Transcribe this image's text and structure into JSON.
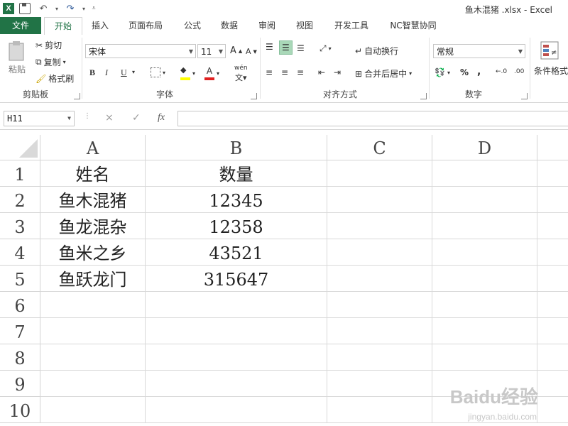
{
  "window": {
    "title": "鱼木混猪 .xlsx - Excel"
  },
  "tabs": [
    "文件",
    "开始",
    "插入",
    "页面布局",
    "公式",
    "数据",
    "审阅",
    "视图",
    "开发工具",
    "NC智慧协同"
  ],
  "ribbon": {
    "clipboard": {
      "paste": "粘贴",
      "cut": "剪切",
      "copy": "复制",
      "format_painter": "格式刷",
      "label": "剪贴板"
    },
    "font": {
      "name": "宋体",
      "size": "11",
      "label": "字体",
      "bold": "B",
      "italic": "I",
      "underline": "U",
      "phonetic": "wén"
    },
    "align": {
      "wrap": "自动换行",
      "merge": "合并后居中",
      "label": "对齐方式"
    },
    "number": {
      "format": "常规",
      "label": "数字",
      "percent": "%",
      "comma": ","
    },
    "styles": {
      "conditional": "条件格式"
    }
  },
  "formula_bar": {
    "name_box": "H11",
    "fx": "fx",
    "cancel": "×",
    "enter": "✓",
    "value": ""
  },
  "columns": [
    "A",
    "B",
    "C",
    "D"
  ],
  "rows": [
    "1",
    "2",
    "3",
    "4",
    "5",
    "6",
    "7",
    "8",
    "9",
    "10"
  ],
  "cells": [
    [
      "姓名",
      "数量"
    ],
    [
      "鱼木混猪",
      "12345"
    ],
    [
      "鱼龙混杂",
      "12358"
    ],
    [
      "鱼米之乡",
      "43521"
    ],
    [
      "鱼跃龙门",
      "315647"
    ]
  ],
  "watermark": {
    "brand": "Baidu经验",
    "url": "jingyan.baidu.com"
  }
}
